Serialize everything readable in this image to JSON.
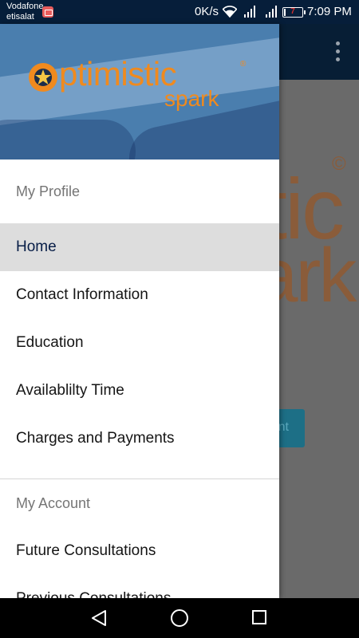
{
  "status_bar": {
    "carrier_line1": "Vodafone",
    "carrier_line2": "etisalat",
    "net_speed": "0K/s",
    "battery_level": "7",
    "battery_fraction": 0.07,
    "time": "7:09 PM",
    "icons": [
      "notification-icon",
      "wifi-icon",
      "signal-icon",
      "signal-icon",
      "battery-icon"
    ]
  },
  "background_app": {
    "logo_line1": "tic",
    "logo_line2": "ark",
    "copyright": "©",
    "button_text": "nt"
  },
  "drawer": {
    "logo": {
      "main_text": "ptimistic",
      "sub_text": "spark",
      "registered": "®",
      "brand_color": "#f08a1e"
    },
    "sections": [
      {
        "title": "My Profile",
        "items": [
          "Home",
          "Contact Information",
          "Education",
          "Availablilty Time",
          "Charges and Payments"
        ]
      },
      {
        "title": "My Account",
        "items": [
          "Future Consultations",
          "Previous Consultations"
        ]
      }
    ],
    "selected_item": "Home"
  },
  "nav_bar": {
    "icons": [
      "back-icon",
      "home-icon",
      "recent-apps-icon"
    ]
  }
}
